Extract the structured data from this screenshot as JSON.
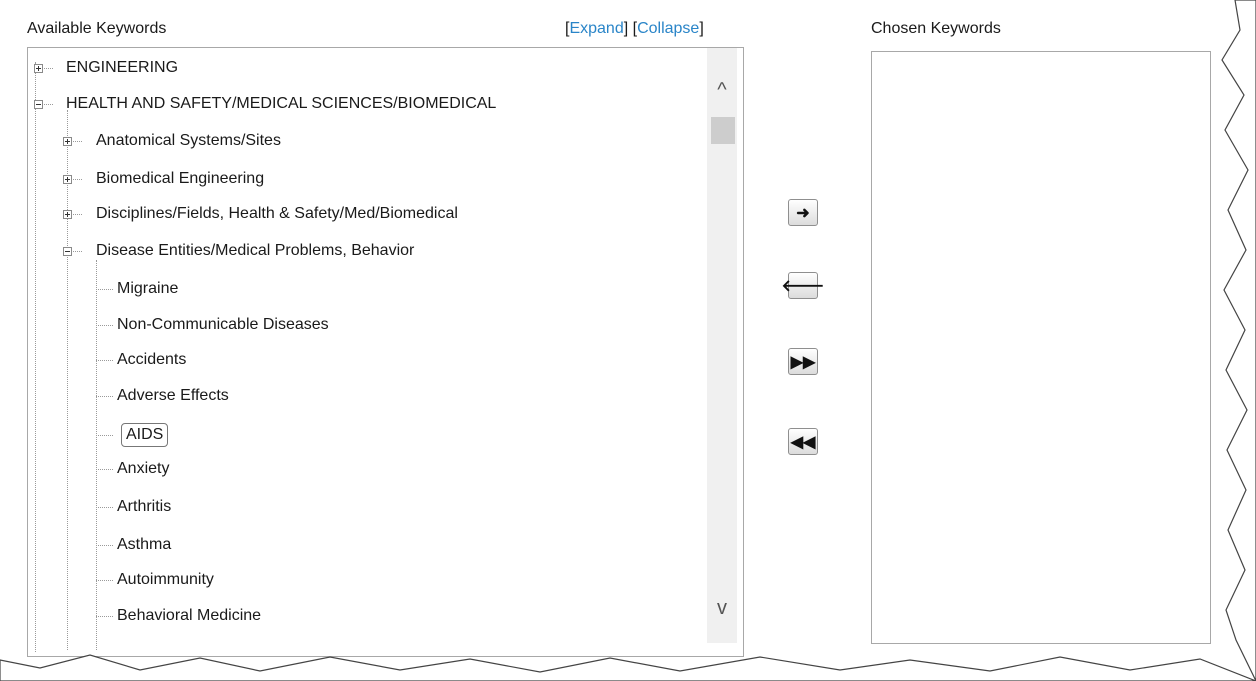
{
  "available": {
    "label": "Available Keywords",
    "expand": "Expand",
    "collapse": "Collapse"
  },
  "chosen": {
    "label": "Chosen Keywords"
  },
  "tree": [
    {
      "label": "ENGINEERING",
      "state": "collapsed"
    },
    {
      "label": "HEALTH AND SAFETY/MEDICAL SCIENCES/BIOMEDICAL",
      "state": "expanded"
    },
    {
      "label": "Anatomical Systems/Sites",
      "state": "collapsed"
    },
    {
      "label": "Biomedical Engineering",
      "state": "collapsed"
    },
    {
      "label": "Disciplines/Fields, Health & Safety/Med/Biomedical",
      "state": "collapsed"
    },
    {
      "label": "Disease Entities/Medical Problems, Behavior",
      "state": "expanded"
    },
    {
      "label": "Migraine"
    },
    {
      "label": "Non-Communicable Diseases"
    },
    {
      "label": "Accidents"
    },
    {
      "label": "Adverse Effects"
    },
    {
      "label": "AIDS",
      "selected": true
    },
    {
      "label": "Anxiety"
    },
    {
      "label": "Arthritis"
    },
    {
      "label": "Asthma"
    },
    {
      "label": "Autoimmunity"
    },
    {
      "label": "Behavioral Medicine"
    }
  ],
  "buttons": [
    {
      "name": "add-selected-button",
      "glyph": "➜"
    },
    {
      "name": "remove-selected-button",
      "glyph": "🡐"
    },
    {
      "name": "add-all-button",
      "glyph": "▶▶"
    },
    {
      "name": "remove-all-button",
      "glyph": "◀◀"
    }
  ],
  "scroll": {
    "up": "^",
    "down": "v"
  }
}
